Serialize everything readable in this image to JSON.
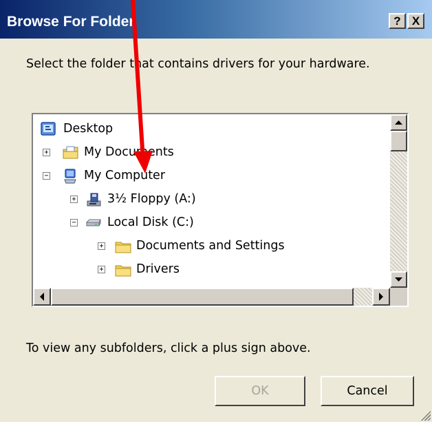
{
  "window": {
    "title": "Browse For Folder",
    "help_label": "?",
    "close_label": "X"
  },
  "instructions": "Select the folder that contains drivers for your hardware.",
  "tree": {
    "items": [
      {
        "label": "Desktop",
        "icon": "desktop-icon",
        "expander": ""
      },
      {
        "label": "My Documents",
        "icon": "my-documents-icon",
        "expander": "+"
      },
      {
        "label": "My Computer",
        "icon": "my-computer-icon",
        "expander": "−"
      },
      {
        "label": "3½ Floppy (A:)",
        "icon": "floppy-drive-icon",
        "expander": "+"
      },
      {
        "label": "Local Disk (C:)",
        "icon": "hard-disk-icon",
        "expander": "−"
      },
      {
        "label": "Documents and Settings",
        "icon": "folder-icon",
        "expander": "+"
      },
      {
        "label": "Drivers",
        "icon": "folder-icon",
        "expander": "+"
      }
    ]
  },
  "hint": "To view any subfolders, click a plus sign above.",
  "buttons": {
    "ok_label": "OK",
    "cancel_label": "Cancel"
  },
  "colors": {
    "title_start": "#0a246a",
    "title_end": "#a6caf0",
    "dialog_face": "#ece9d8",
    "annotation_arrow": "#ee0000"
  }
}
